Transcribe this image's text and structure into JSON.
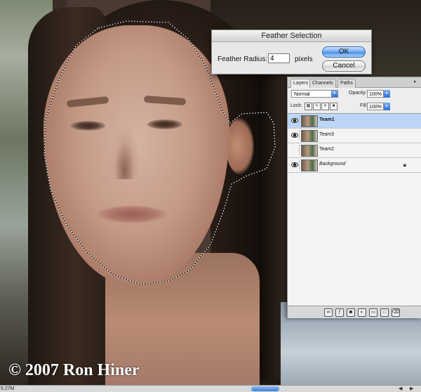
{
  "canvas": {
    "watermark": "© 2007 Ron Hiner",
    "doc_size": "5.27M"
  },
  "dialog": {
    "title": "Feather Selection",
    "label": "Feather Radius:",
    "value": "4",
    "unit": "pixels",
    "ok": "OK",
    "cancel": "Cancel"
  },
  "layers_panel": {
    "tabs": [
      "Layers",
      "Channels",
      "Paths"
    ],
    "blend_mode": "Normal",
    "opacity_label": "Opacity:",
    "opacity": "100%",
    "lock_label": "Lock:",
    "fill_label": "Fill:",
    "fill": "100%",
    "layers": [
      {
        "name": "Team1",
        "visible": true,
        "selected": true
      },
      {
        "name": "Team3",
        "visible": true,
        "selected": false
      },
      {
        "name": "Team2",
        "visible": false,
        "selected": false
      },
      {
        "name": "Background",
        "visible": true,
        "selected": false,
        "locked": true
      }
    ]
  },
  "colors": {
    "selection_highlight": "#bcd6f7",
    "ok_button": "#4a8ee6"
  }
}
